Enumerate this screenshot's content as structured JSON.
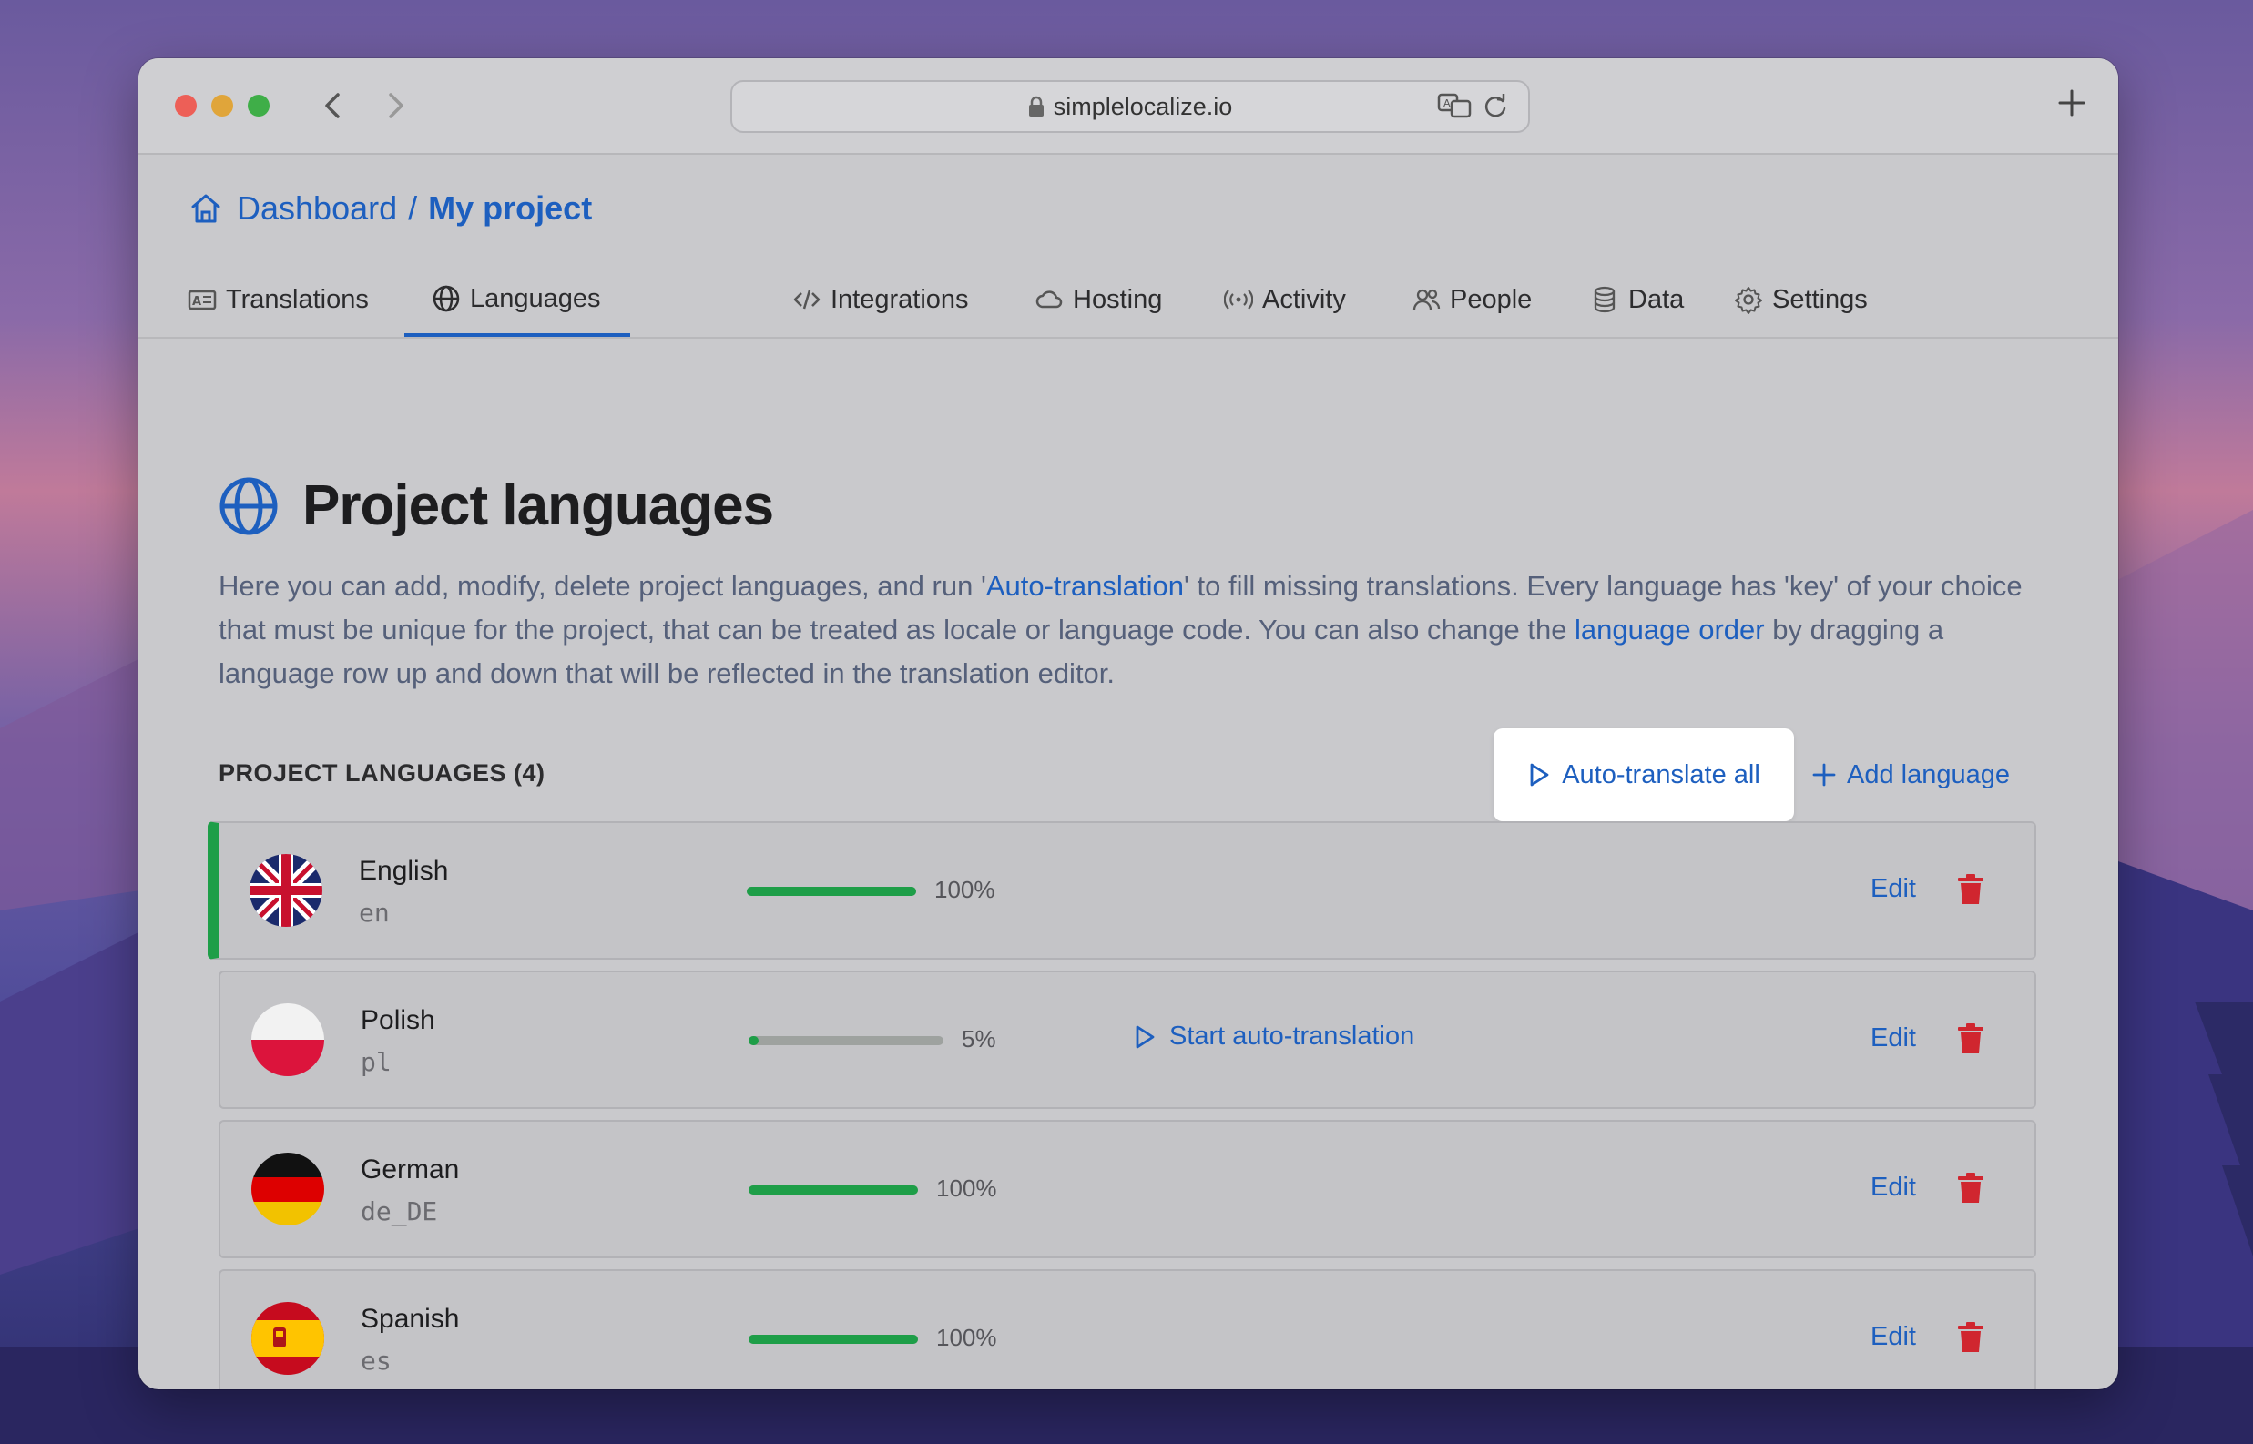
{
  "browser": {
    "url": "simplelocalize.io",
    "icons": [
      "back-chevron-icon",
      "forward-chevron-icon",
      "lock-icon",
      "translate-icon",
      "reload-icon",
      "new-tab-plus-icon"
    ]
  },
  "breadcrumb": {
    "home": "Dashboard",
    "separator": "/",
    "current": "My project"
  },
  "tabs": [
    {
      "label": "Translations",
      "icon": "translations-icon"
    },
    {
      "label": "Languages",
      "icon": "globe-icon",
      "active": true
    },
    {
      "label": "Integrations",
      "icon": "code-icon"
    },
    {
      "label": "Hosting",
      "icon": "cloud-icon"
    },
    {
      "label": "Activity",
      "icon": "broadcast-icon"
    },
    {
      "label": "People",
      "icon": "people-icon"
    },
    {
      "label": "Data",
      "icon": "database-icon"
    },
    {
      "label": "Settings",
      "icon": "gear-icon"
    }
  ],
  "page": {
    "title": "Project languages",
    "desc_1": "Here you can add, modify, delete project languages, and run '",
    "desc_link_1": "Auto-translation",
    "desc_2": "' to fill missing translations. Every language has 'key' of your choice that must be unique for the project, that can be treated as locale or language code. You can also change the ",
    "desc_link_2": "language order",
    "desc_3": " by dragging a language row up and down that will be reflected in the translation editor."
  },
  "languages_section": {
    "label": "PROJECT LANGUAGES (4)",
    "auto_translate_all": "Auto-translate all",
    "add_language": "Add language",
    "edit_label": "Edit",
    "start_auto_label": "Start auto-translation"
  },
  "languages": [
    {
      "name": "English",
      "code": "en",
      "progress": "100%",
      "progress_value": 1.0,
      "flag": "uk-flag"
    },
    {
      "name": "Polish",
      "code": "pl",
      "progress": "5%",
      "progress_value": 0.05,
      "flag": "poland-flag",
      "auto_translate": true
    },
    {
      "name": "German",
      "code": "de_DE",
      "progress": "100%",
      "progress_value": 1.0,
      "flag": "germany-flag"
    },
    {
      "name": "Spanish",
      "code": "es",
      "progress": "100%",
      "progress_value": 1.0,
      "flag": "spain-flag"
    }
  ],
  "colors": {
    "accent": "#1d5fbf",
    "progress_fill": "#1e9e48",
    "delete": "#d0262f"
  }
}
